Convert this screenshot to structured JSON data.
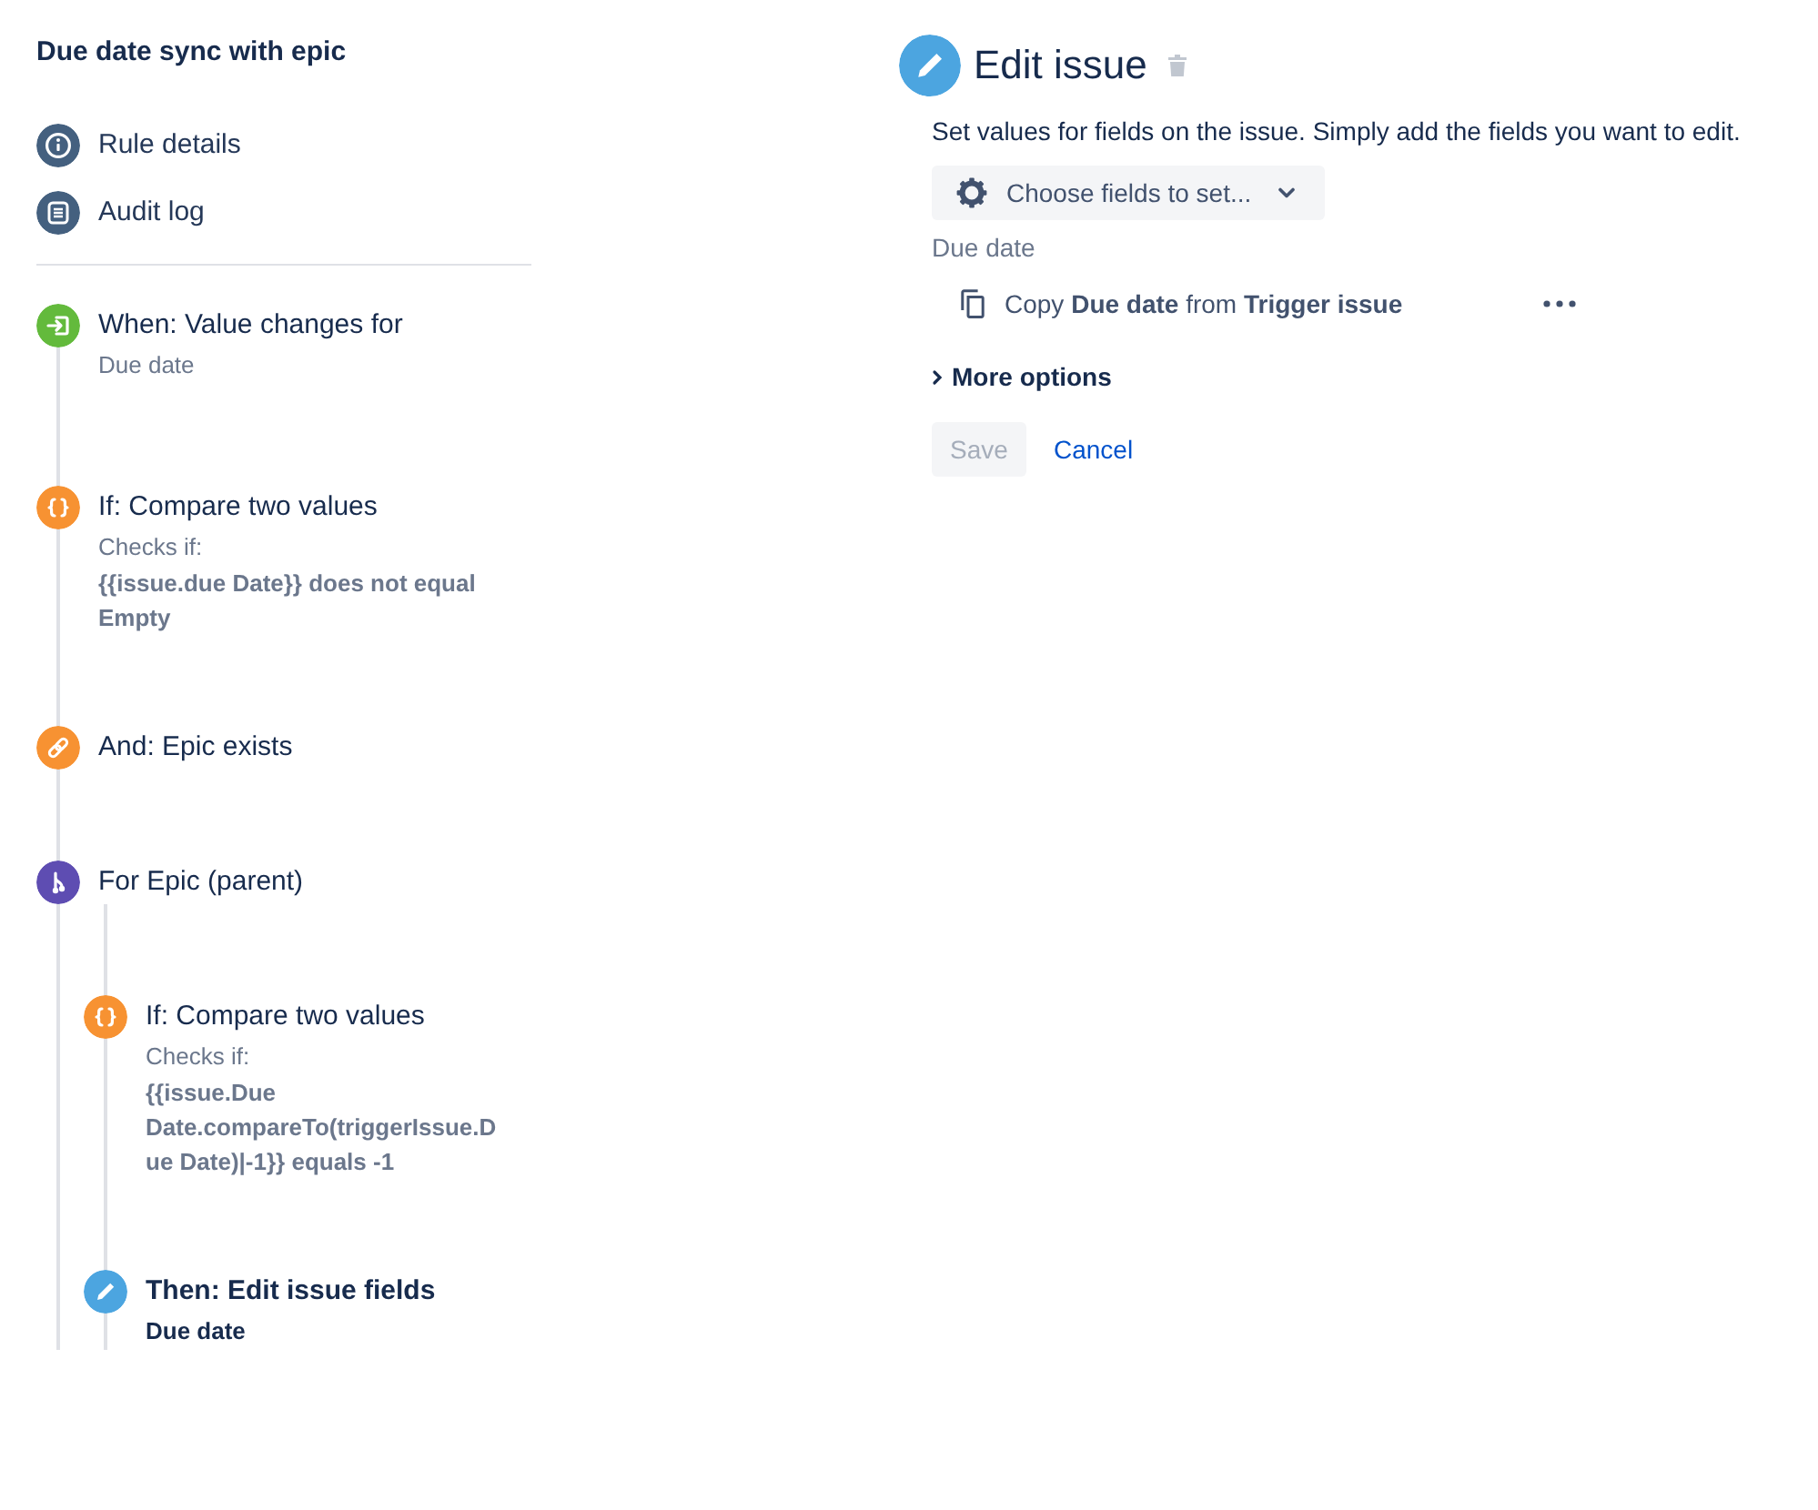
{
  "sidebar": {
    "title": "Due date sync with epic",
    "links": [
      {
        "label": "Rule details",
        "kind": "details"
      },
      {
        "label": "Audit log",
        "kind": "audit"
      }
    ]
  },
  "rule": {
    "components": [
      {
        "kind": "trigger",
        "title": "When: Value changes for",
        "detail": "Due date",
        "selected": false
      },
      {
        "kind": "compare",
        "title": "If: Compare two values",
        "caption": "Checks if:",
        "detail": "{{issue.due Date}} does not equal Empty",
        "selected": false
      },
      {
        "kind": "related",
        "title": "And: Epic exists",
        "selected": false
      },
      {
        "kind": "branch",
        "title": "For Epic (parent)",
        "selected": false,
        "children": [
          {
            "kind": "compare",
            "title": "If: Compare two values",
            "caption": "Checks if:",
            "detail": "{{issue.Due Date.compareTo(triggerIssue.Due Date)|-1}} equals -1",
            "selected": false
          },
          {
            "kind": "action",
            "title": "Then: Edit issue fields",
            "detail": "Due date",
            "selected": true
          }
        ]
      }
    ]
  },
  "editor": {
    "title": "Edit issue",
    "description": "Set values for fields on the issue. Simply add the fields you want to edit.",
    "field_picker": {
      "label": "Choose fields to set..."
    },
    "fields": [
      {
        "label": "Due date",
        "value": "Copy **Due date** from **Trigger issue**"
      }
    ],
    "more_options": {
      "label": "More options",
      "expanded": false
    },
    "buttons": [
      {
        "label": "Save",
        "kind": "button",
        "disabled": true
      },
      {
        "label": "Cancel",
        "kind": "link",
        "disabled": false
      }
    ]
  }
}
